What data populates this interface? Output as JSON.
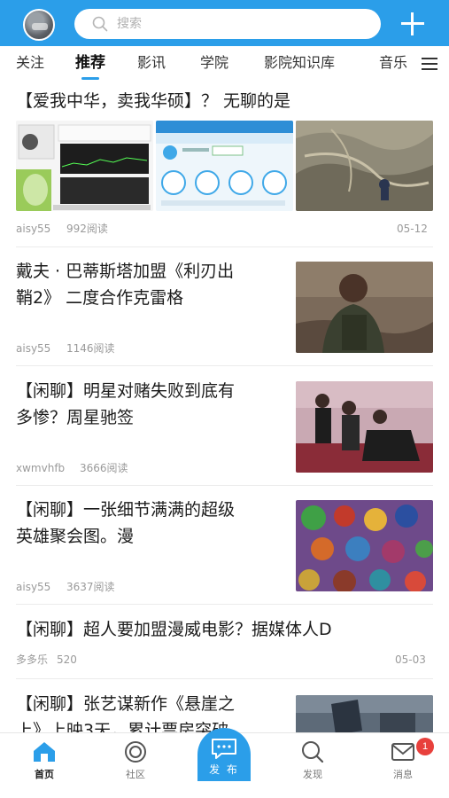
{
  "header": {
    "search_placeholder": "搜索"
  },
  "tabs": [
    {
      "label": "关注"
    },
    {
      "label": "推荐"
    },
    {
      "label": "影讯"
    },
    {
      "label": "学院"
    },
    {
      "label": "影院知识库"
    },
    {
      "label": "音乐"
    }
  ],
  "feed": [
    {
      "title": "【爱我中华，卖我华硕】？ 无聊的是",
      "author": "aisy55",
      "reads": "992阅读",
      "date": "05-12"
    },
    {
      "title": "戴夫 · 巴蒂斯塔加盟《利刃出鞘2》 二度合作克雷格",
      "title_line1": "戴夫 · 巴蒂斯塔加盟《利刃出",
      "title_line2": "鞘2》 二度合作克雷格",
      "author": "aisy55",
      "reads": "1146阅读"
    },
    {
      "title_line1": "【闲聊】明星对赌失败到底有",
      "title_line2": "多惨？周星驰签",
      "author": "xwmvhfb",
      "reads": "3666阅读"
    },
    {
      "title_line1": "【闲聊】一张细节满满的超级",
      "title_line2": "英雄聚会图。漫",
      "author": "aisy55",
      "reads": "3637阅读"
    },
    {
      "title": "【闲聊】超人要加盟漫威电影？据媒体人D",
      "author": "多多乐",
      "reads": "520",
      "date": "05-03"
    },
    {
      "title_line1": "【闲聊】张艺谋新作《悬崖之",
      "title_line2": "上》上映3天，累计票房突破"
    }
  ],
  "bottom_nav": {
    "home": "首页",
    "community": "社区",
    "publish": "发 布",
    "discover": "发现",
    "messages": "消息",
    "message_badge": "1"
  },
  "colors": {
    "accent": "#2b9ee9",
    "badge": "#e8403c"
  }
}
